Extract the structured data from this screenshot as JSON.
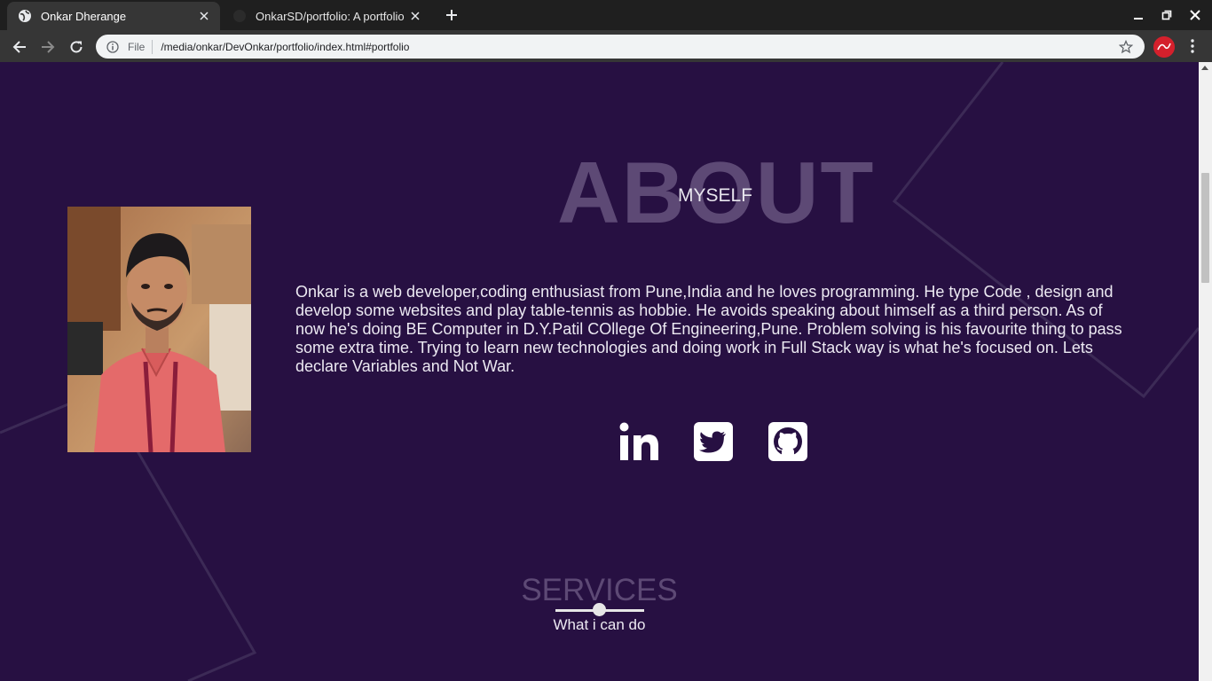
{
  "browser": {
    "tabs": [
      {
        "title": "Onkar Dherange",
        "active": true
      },
      {
        "title": "OnkarSD/portfolio: A portfolio",
        "active": false
      }
    ],
    "address": {
      "scheme_label": "File",
      "url": "/media/onkar/DevOnkar/portfolio/index.html#portfolio"
    },
    "icons": [
      "back-icon",
      "forward-icon",
      "reload-icon",
      "info-icon",
      "star-icon",
      "menu-icon",
      "minimize-icon",
      "maximize-icon",
      "close-icon",
      "new-tab-icon"
    ]
  },
  "about": {
    "title_big": "ABOUT",
    "title_small": "MYSELF",
    "bio": "Onkar is a web developer,coding enthusiast from Pune,India and he loves programming. He type Code , design and develop some websites and play table-tennis as hobbie. He avoids speaking about himself as a third person. As of now he's doing BE Computer in D.Y.Patil COllege Of Engineering,Pune. Problem solving is his favourite thing to pass some extra time. Trying to learn new technologies and doing work in Full Stack way is what he's focused on. Lets declare Variables and Not War.",
    "social": [
      "linkedin-icon",
      "twitter-icon",
      "github-icon"
    ]
  },
  "services": {
    "title": "SERVICES",
    "subtitle": "What i can do"
  },
  "colors": {
    "page_bg": "#271042",
    "heading_faded": "#5d4975",
    "text": "#ece9f2"
  }
}
